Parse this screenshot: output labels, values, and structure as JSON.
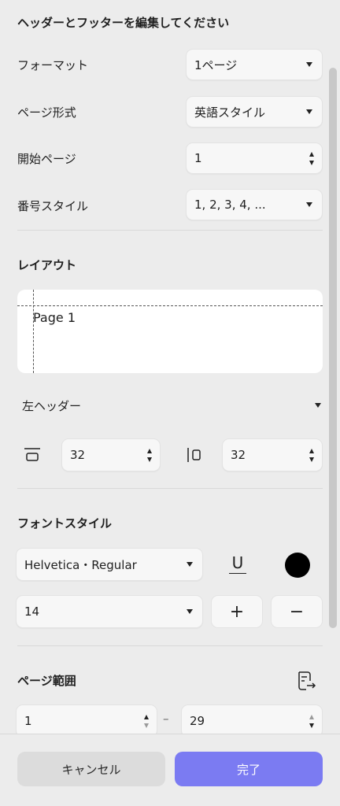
{
  "header": {
    "title": "ヘッダーとフッターを編集してください"
  },
  "fields": {
    "format": {
      "label": "フォーマット",
      "value": "1ページ"
    },
    "page_format": {
      "label": "ページ形式",
      "value": "英語スタイル"
    },
    "start_page": {
      "label": "開始ページ",
      "value": "1"
    },
    "number_style": {
      "label": "番号スタイル",
      "value": "1, 2, 3, 4, ..."
    }
  },
  "layout": {
    "title": "レイアウト",
    "preview_text": "Page 1",
    "position_select": "左ヘッダー",
    "top_margin": "32",
    "left_margin": "32"
  },
  "font_style": {
    "title": "フォントスタイル",
    "font": "Helvetica・Regular",
    "size": "14",
    "underline_glyph": "U",
    "plus": "+",
    "minus": "−",
    "text_color": "#000000"
  },
  "page_range": {
    "title": "ページ範囲",
    "from": "1",
    "to": "29",
    "separator": "–"
  },
  "footer": {
    "cancel_label": "キャンセル",
    "done_label": "完了"
  },
  "colors": {
    "accent": "#7b7bf2",
    "background": "#ececec"
  }
}
